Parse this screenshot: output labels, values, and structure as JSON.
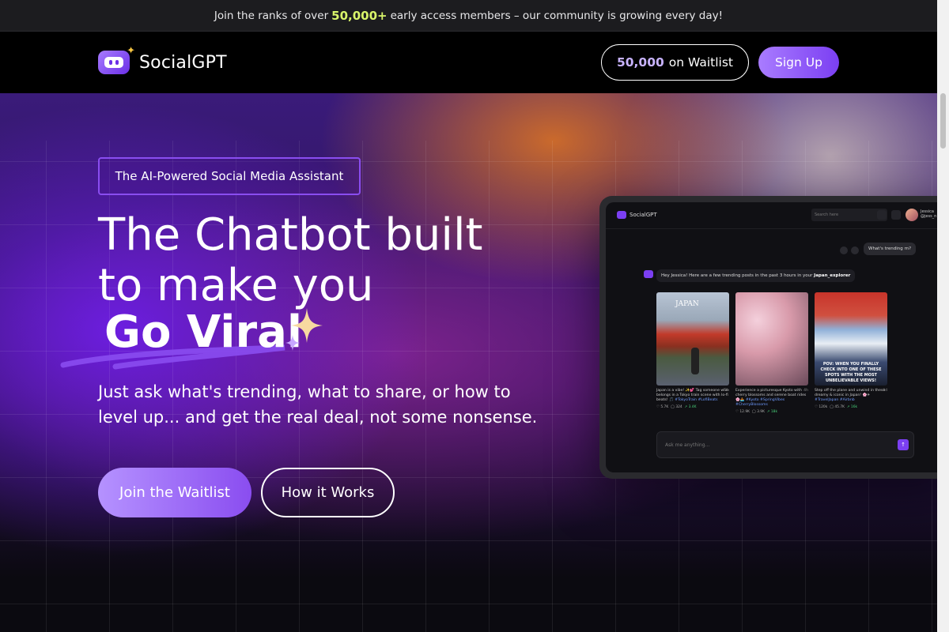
{
  "announcement": {
    "prefix": "Join the ranks of over",
    "highlight": "50,000+",
    "suffix": "early access members – our community is growing every day!"
  },
  "nav": {
    "brand": "SocialGPT",
    "waitlist_count": "50,000",
    "waitlist_suffix": "on Waitlist",
    "signup_label": "Sign Up"
  },
  "hero": {
    "tagline": "The AI-Powered Social Media Assistant",
    "headline_line1": "The Chatbot built",
    "headline_line2": "to make you",
    "headline_highlight": "Go Viral",
    "subtext": "Just ask what's trending, what to share, or how to level up... and get the real deal, not some nonsense.",
    "primary_cta": "Join the Waitlist",
    "secondary_cta": "How it Works"
  },
  "mockup": {
    "brand": "SocialGPT",
    "search_placeholder": "Search here",
    "user_name": "Jessica",
    "user_handle": "@jess_n",
    "user_message": "What's trending rn?",
    "bot_message_prefix": "Hey Jessica! Here are a few trending posts in the past 3 hours in your",
    "bot_message_location": "Japan_explorer",
    "posts": [
      {
        "banner": "JAPAN",
        "caption": "Japan is a vibe! ✨💕 Tag someone who belongs in a Tokyo train scene with lo-fi beats! 🎵",
        "tags": "#TokyoTrain #LofiBeats",
        "time": "2h",
        "likes": "5.7K",
        "comments": "324",
        "shares": "3.4K"
      },
      {
        "banner": "",
        "caption": "Experience a picturesque Kyoto with cherry blossoms and serene boat rides 🌸🚣",
        "tags": "#Kyoto #SpringVibes #CherryBlossoms",
        "time": "4h",
        "likes": "12.9K",
        "comments": "3.9K",
        "shares": "18k"
      },
      {
        "banner": "POV: WHEN YOU FINALLY CHECK INTO ONE OF THESE SPOTS WITH THE MOST UNBELIEVABLE VIEWS!",
        "caption": "Step off the plane and unwind in these dreamy & iconic in Japan! 🌸✈",
        "tags": "#TravelJapan #Airbnb",
        "time": "4d",
        "likes": "120k",
        "comments": "45.7K",
        "shares": "16k"
      }
    ],
    "input_placeholder": "Ask me anything..."
  },
  "colors": {
    "accent": "#8a4df0",
    "highlight_green": "#d9f56a",
    "background": "#000000"
  }
}
